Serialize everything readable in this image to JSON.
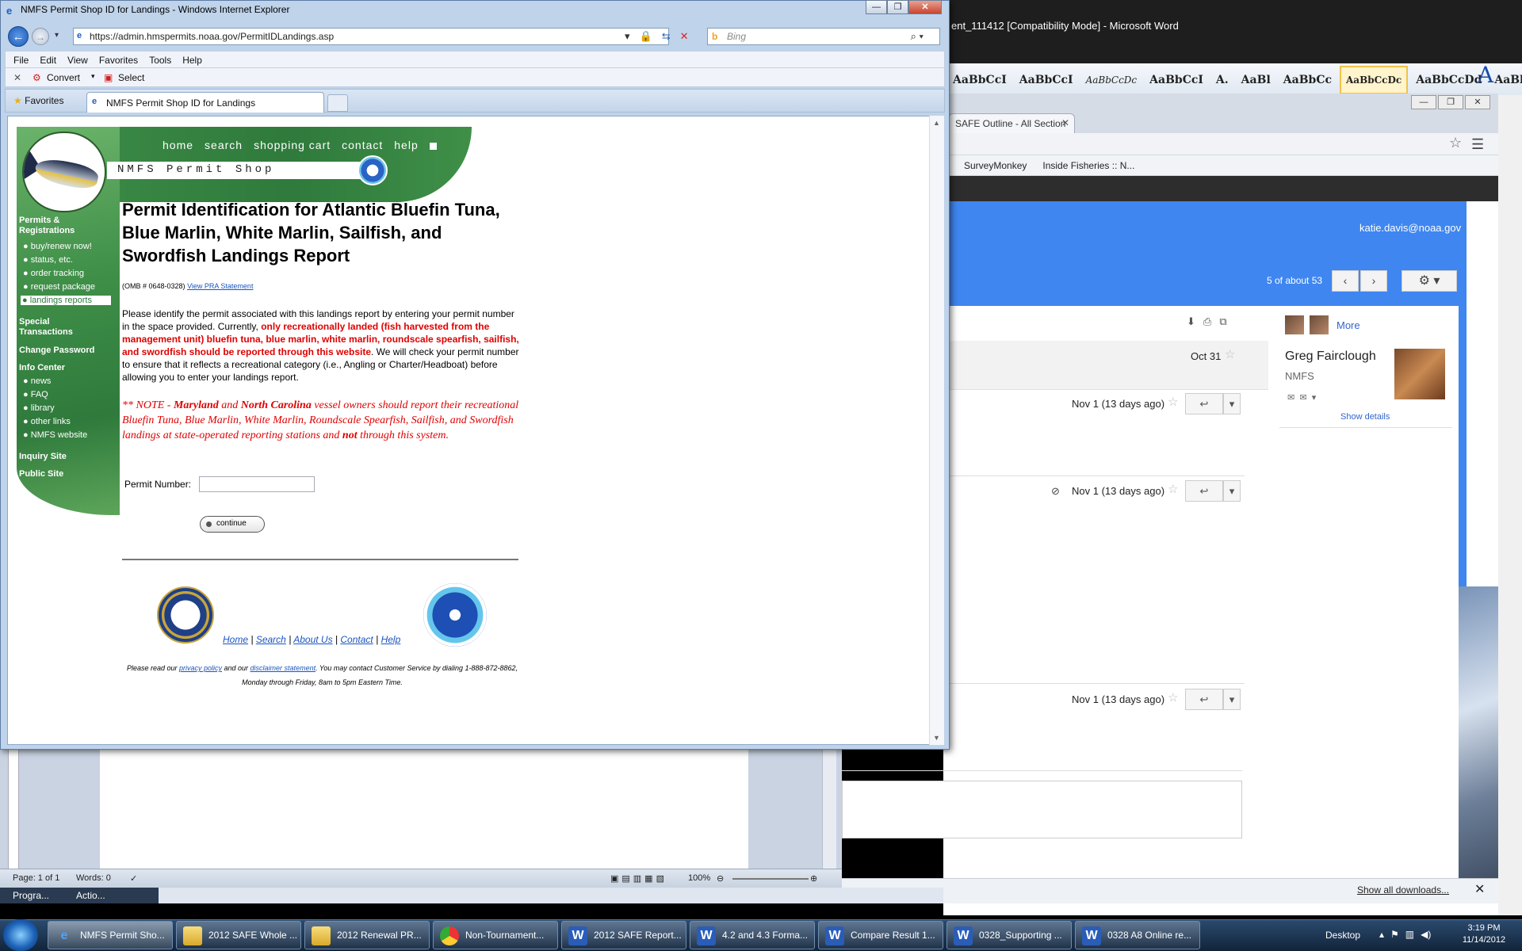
{
  "word": {
    "title": "ent_111412 [Compatibility Mode] - Microsoft Word",
    "styles": [
      "AaBbCcI",
      "AaBbCcI",
      "AaBbCcDc",
      "AaBbCcI",
      "A.",
      "AaBl",
      "AaBbCc",
      "AaBbCcDc",
      "AaBbCcDd",
      "AaBbCcI"
    ],
    "change_styles_glyph": "A",
    "status_page": "Page: 1 of 1",
    "status_words": "Words: 0",
    "zoom": "100%"
  },
  "chrome": {
    "tab_title": "SAFE Outline - All Section",
    "bookmarks": [
      "SurveyMonkey",
      "Inside Fisheries :: N..."
    ],
    "downloads_link": "Show all downloads..."
  },
  "gmail": {
    "user": "katie.davis@noaa.gov",
    "count": "5 of about 53",
    "more": "More",
    "contact_name": "Greg Fairclough",
    "contact_org": "NMFS",
    "show_details": "Show details",
    "dates": [
      "Oct 31",
      "Nov 1 (13 days ago)",
      "Nov 1 (13 days ago)",
      "Nov 1 (13 days ago)"
    ]
  },
  "ie": {
    "title": "NMFS Permit Shop ID for Landings - Windows Internet Explorer",
    "url": "https://admin.hmspermits.noaa.gov/PermitIDLandings.asp",
    "search_placeholder": "Bing",
    "menu": [
      "File",
      "Edit",
      "View",
      "Favorites",
      "Tools",
      "Help"
    ],
    "cmd_convert": "Convert",
    "cmd_select": "Select",
    "favorites": "Favorites",
    "tab_title": "NMFS Permit Shop ID for Landings"
  },
  "page": {
    "top_nav": [
      "home",
      "search",
      "shopping cart",
      "contact",
      "help"
    ],
    "shop_title": "NMFS Permit Shop",
    "side_nav": {
      "permits_head": "Permits & Registrations",
      "permits_items": [
        "buy/renew now!",
        "status, etc.",
        "order tracking",
        "request package",
        "landings reports"
      ],
      "special": "Special Transactions",
      "change_password": "Change Password",
      "info_center": "Info Center",
      "info_items": [
        "news",
        "FAQ",
        "library",
        "other links",
        "NMFS website"
      ],
      "inquiry": "Inquiry Site",
      "public": "Public Site"
    },
    "heading": "Permit Identification for Atlantic Bluefin Tuna, Blue Marlin, White Marlin, Sailfish, and Swordfish Landings Report",
    "omb": "(OMB # 0648-0328)",
    "pra_link": "View PRA Statement",
    "para_start": "Please identify the permit associated with this landings report by entering your permit number in the space provided. Currently, ",
    "para_red": "only recreationally landed (fish harvested from the management unit) bluefin tuna, blue marlin, white marlin, roundscale spearfish, sailfish, and swordfish should be reported through this website",
    "para_end": ". We will check your permit number to ensure that it reflects a recreational category (i.e., Angling or Charter/Headboat) before allowing you to enter your landings report.",
    "note_1": "** NOTE - ",
    "note_md": "Maryland",
    "note_and": " and ",
    "note_nc": "North Carolina",
    "note_2": " vessel owners should report their recreational Bluefin Tuna, Blue Marlin, White Marlin, Roundscale Spearfish, Sailfish, and Swordfish landings at state-operated reporting stations and ",
    "note_not": "not",
    "note_3": " through this system.",
    "permit_label": "Permit Number:",
    "permit_value": "",
    "continue": "continue",
    "footer_links": [
      "Home",
      "Search",
      "About Us",
      "Contact",
      "Help"
    ],
    "footer_sep": "|",
    "footer_1": "Please read our ",
    "footer_privacy": "privacy policy",
    "footer_2": " and our ",
    "footer_disclaimer": "disclaimer statement",
    "footer_3": ". You may contact Customer Service by dialing 1-888-872-8862, Monday through Friday, 8am to 5pm Eastern Time."
  },
  "background_labels": {
    "prog": "Progra...",
    "actio": "Actio..."
  },
  "taskbar": {
    "items": [
      {
        "label": "NMFS Permit Sho...",
        "icon": "ie-icon"
      },
      {
        "label": "2012 SAFE Whole ...",
        "icon": "folder-icon"
      },
      {
        "label": "2012 Renewal PR...",
        "icon": "folder-icon"
      },
      {
        "label": "Non-Tournament...",
        "icon": "chrome-icon"
      },
      {
        "label": "2012 SAFE Report...",
        "icon": "word-icon"
      },
      {
        "label": "4.2 and 4.3 Forma...",
        "icon": "word-icon"
      },
      {
        "label": "Compare Result 1...",
        "icon": "word-icon"
      },
      {
        "label": "0328_Supporting ...",
        "icon": "word-icon"
      },
      {
        "label": "0328 A8 Online re...",
        "icon": "word-icon"
      }
    ],
    "desktop": "Desktop",
    "time": "3:19 PM",
    "date": "11/14/2012"
  }
}
